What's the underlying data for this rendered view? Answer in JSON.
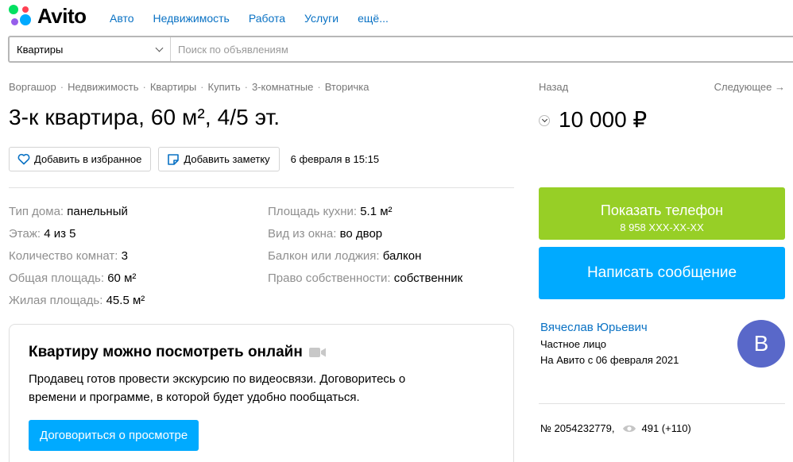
{
  "brand": {
    "name": "Avito"
  },
  "topnav": [
    "Авто",
    "Недвижимость",
    "Работа",
    "Услуги",
    "ещё..."
  ],
  "search": {
    "category": "Квартиры",
    "placeholder": "Поиск по объявлениям",
    "value": ""
  },
  "breadcrumb": [
    "Воргашор",
    "Недвижимость",
    "Квартиры",
    "Купить",
    "3-комнатные",
    "Вторичка"
  ],
  "title": "3-к квартира, 60 м², 4/5 эт.",
  "actions": {
    "favorite_label": "Добавить в избранное",
    "note_label": "Добавить заметку",
    "date": "6 февраля в 15:15"
  },
  "params_left": [
    {
      "key": "Тип дома: ",
      "value": "панельный"
    },
    {
      "key": "Этаж: ",
      "value": "4 из 5"
    },
    {
      "key": "Количество комнат: ",
      "value": "3"
    },
    {
      "key": "Общая площадь: ",
      "value": "60 м²"
    },
    {
      "key": "Жилая площадь: ",
      "value": "45.5 м²"
    }
  ],
  "params_right": [
    {
      "key": "Площадь кухни: ",
      "value": "5.1 м²"
    },
    {
      "key": "Вид из окна: ",
      "value": "во двор"
    },
    {
      "key": "Балкон или лоджия: ",
      "value": "балкон"
    },
    {
      "key": "Право собственности: ",
      "value": "собственник"
    }
  ],
  "online_view": {
    "title": "Квартиру можно посмотреть онлайн",
    "text": "Продавец готов провести экскурсию по видеосвязи. Договоритесь о времени и программе, в которой будет удобно пообщаться.",
    "button": "Договориться о просмотре"
  },
  "nav": {
    "back": "Назад",
    "next": "Следующее →"
  },
  "price": "10 000 ₽",
  "phone_button": {
    "label": "Показать телефон",
    "number": "8 958 XXX-XX-XX"
  },
  "message_button": "Написать сообщение",
  "seller": {
    "name": "Вячеслав Юрьевич",
    "type": "Частное лицо",
    "since": "На Авито с 06 февраля 2021",
    "avatar_letter": "В"
  },
  "meta": {
    "ad_number": "№ 2054232779,",
    "views": "491 (+110)"
  },
  "colors": {
    "link": "#0a72c4",
    "green": "#97cf26",
    "blue": "#00aaff",
    "avatar": "#5968c9"
  }
}
